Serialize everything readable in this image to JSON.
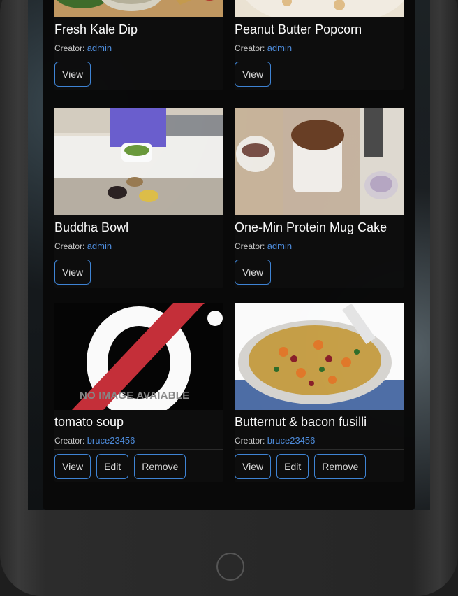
{
  "recipes": [
    {
      "title": "Fresh Kale Dip",
      "creator_label": "Creator:",
      "creator": "admin",
      "buttons": [
        "View"
      ]
    },
    {
      "title": "Peanut Butter Popcorn",
      "creator_label": "Creator:",
      "creator": "admin",
      "buttons": [
        "View"
      ]
    },
    {
      "title": "Buddha Bowl",
      "creator_label": "Creator:",
      "creator": "admin",
      "buttons": [
        "View"
      ]
    },
    {
      "title": "One-Min Protein Mug Cake",
      "creator_label": "Creator:",
      "creator": "admin",
      "buttons": [
        "View"
      ]
    },
    {
      "title": "tomato soup",
      "creator_label": "Creator:",
      "creator": "bruce23456",
      "buttons": [
        "View",
        "Edit",
        "Remove"
      ],
      "image_text": "NO IMAGE AVAIABLE"
    },
    {
      "title": "Butternut & bacon fusilli",
      "creator_label": "Creator:",
      "creator": "bruce23456",
      "buttons": [
        "View",
        "Edit",
        "Remove"
      ]
    }
  ],
  "colors": {
    "accent": "#3f86d8",
    "link": "#4f8fe0",
    "panel": "#090909"
  }
}
